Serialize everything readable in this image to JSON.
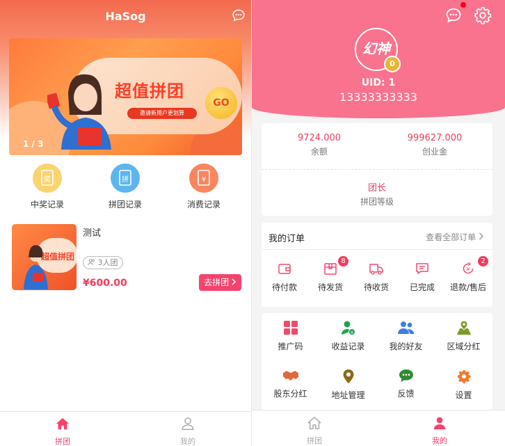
{
  "left": {
    "title": "HaSog",
    "banner": {
      "headline": "超值拼团",
      "sub": "邀请新用户更划算",
      "go": "GO",
      "counter": "1 / 3"
    },
    "categories": [
      {
        "label": "中奖记录",
        "icon": "award-record-icon",
        "glyph": "奖",
        "color": "#fbd36f"
      },
      {
        "label": "拼团记录",
        "icon": "group-record-icon",
        "glyph": "拼",
        "color": "#5db5f0"
      },
      {
        "label": "消费记录",
        "icon": "consume-record-icon",
        "glyph": "¥",
        "color": "#f8865f"
      }
    ],
    "product": {
      "title": "测试",
      "tag": "3人团",
      "price": "¥600.00",
      "button": "去拼团"
    },
    "tabs": [
      {
        "label": "拼团",
        "icon": "home-icon",
        "active": true
      },
      {
        "label": "我的",
        "icon": "user-icon",
        "active": false
      }
    ]
  },
  "right": {
    "avatar_text": "幻神",
    "level": "0",
    "uid": "UID: 1",
    "phone": "13333333333",
    "balances": [
      {
        "value": "9724.000",
        "label": "余额"
      },
      {
        "value": "999627.000",
        "label": "创业金"
      }
    ],
    "role": {
      "value": "团长",
      "label": "拼团等级"
    },
    "orders": {
      "title": "我的订单",
      "view_all": "查看全部订单",
      "items": [
        {
          "label": "待付款",
          "icon": "wallet-icon",
          "badge": ""
        },
        {
          "label": "待发货",
          "icon": "box-icon",
          "badge": "8"
        },
        {
          "label": "待收货",
          "icon": "truck-icon",
          "badge": ""
        },
        {
          "label": "已完成",
          "icon": "message-check-icon",
          "badge": ""
        },
        {
          "label": "退款/售后",
          "icon": "refund-icon",
          "badge": "2"
        }
      ]
    },
    "services": [
      {
        "label": "推广码",
        "icon": "qr-grid-icon",
        "color": "#f04a6b"
      },
      {
        "label": "收益记录",
        "icon": "earnings-icon",
        "color": "#21a34e"
      },
      {
        "label": "我的好友",
        "icon": "friends-icon",
        "color": "#3f7de6"
      },
      {
        "label": "区域分红",
        "icon": "region-icon",
        "color": "#7c9a2a"
      },
      {
        "label": "股东分红",
        "icon": "handshake-icon",
        "color": "#e06a3a"
      },
      {
        "label": "地址管理",
        "icon": "location-pin-icon",
        "color": "#8a6a18"
      },
      {
        "label": "反馈",
        "icon": "feedback-icon",
        "color": "#2f8a33"
      },
      {
        "label": "设置",
        "icon": "settings-icon",
        "color": "#f07a2e"
      }
    ],
    "tabs": [
      {
        "label": "拼团",
        "icon": "home-icon",
        "active": false
      },
      {
        "label": "我的",
        "icon": "user-icon",
        "active": true
      }
    ]
  },
  "colors": {
    "accent": "#f6436d",
    "profile_bg": "#f9728e",
    "price": "#f53b57"
  }
}
